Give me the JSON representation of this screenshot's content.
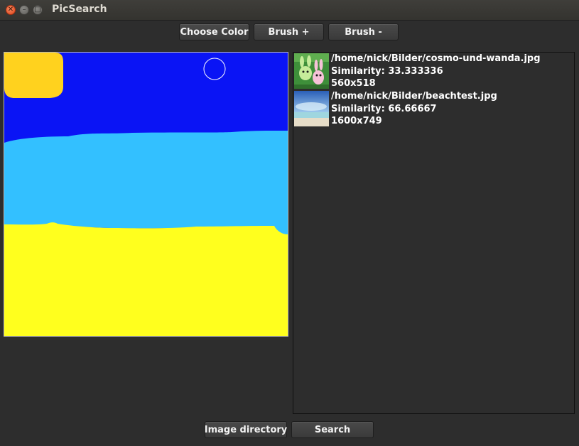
{
  "window": {
    "title": "PicSearch"
  },
  "toolbar": {
    "choose_color": "Choose Color",
    "brush_plus": "Brush +",
    "brush_minus": "Brush -"
  },
  "results": [
    {
      "path": "/home/nick/Bilder/cosmo-und-wanda.jpg",
      "similarity": "Similarity: 33.333336",
      "dimensions": "560x518",
      "thumbnail_icon": "cartoon-thumbnail"
    },
    {
      "path": "/home/nick/Bilder/beachtest.jpg",
      "similarity": "Similarity: 66.66667",
      "dimensions": "1600x749",
      "thumbnail_icon": "beach-thumbnail"
    }
  ],
  "footer": {
    "image_directory": "Image directory",
    "search": "Search"
  },
  "colors": {
    "sky": "#0a14f5",
    "sea": "#33c0ff",
    "sand": "#ffff1e",
    "sun": "#ffd21e",
    "background": "#2d2d2d"
  }
}
